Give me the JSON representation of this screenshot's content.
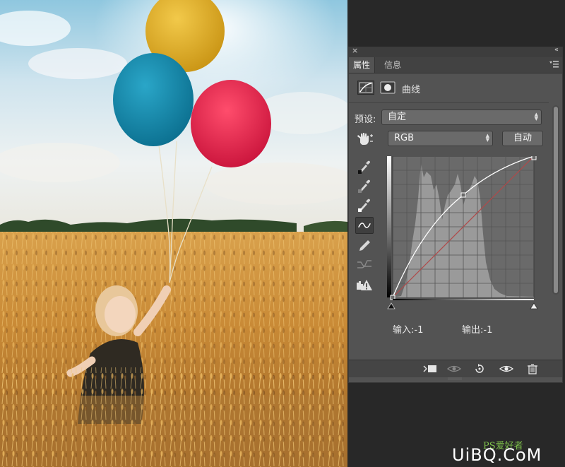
{
  "panel": {
    "close_glyph": "×",
    "collapse_glyph": "«",
    "tabs": [
      {
        "label": "属性",
        "active": true
      },
      {
        "label": "信息",
        "active": false
      }
    ],
    "adjustment_title": "曲线",
    "preset_label": "预设:",
    "preset_value": "自定",
    "channel_value": "RGB",
    "auto_label": "自动",
    "input_readout": "输入:-1",
    "output_readout": "输出:-1"
  },
  "curve": {
    "points": [
      [
        0,
        0
      ],
      [
        64,
        100
      ],
      [
        255,
        255
      ]
    ],
    "note_colors": {
      "curve": "#ffffff",
      "baseline": "#b04a4a",
      "histogram": "#9a9a9a",
      "grid_bg": "#6a6a6a"
    }
  },
  "icons": {
    "tools": [
      "sample-black-point-icon",
      "sample-gray-point-icon",
      "sample-white-point-icon",
      "smooth-curve-icon",
      "pencil-icon",
      "smooth-adjust-icon",
      "clipping-warning-icon"
    ],
    "footer": [
      "clip-to-layer-icon",
      "view-previous-icon",
      "reset-icon",
      "visibility-icon",
      "delete-icon"
    ]
  },
  "watermark": {
    "text": "UiBQ.CoM",
    "small": "PS爱好者"
  }
}
